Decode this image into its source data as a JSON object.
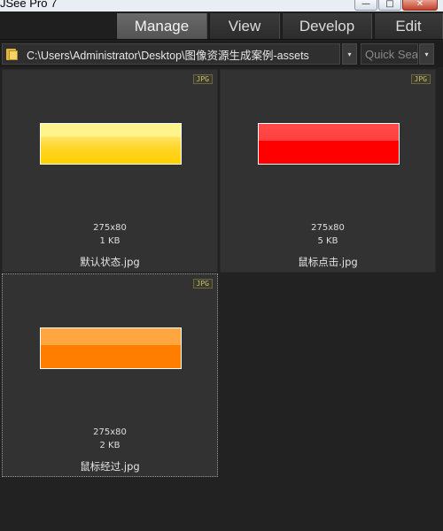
{
  "window": {
    "title": "JSee Pro 7",
    "min_glyph": "—",
    "max_glyph": "□",
    "close_glyph": "✕"
  },
  "mode_tabs": [
    {
      "label": "Manage",
      "active": true
    },
    {
      "label": "View",
      "active": false
    },
    {
      "label": "Develop",
      "active": false
    },
    {
      "label": "Edit",
      "active": false
    }
  ],
  "pathbar": {
    "path": "C:\\Users\\Administrator\\Desktop\\图像资源生成案例-assets",
    "search_placeholder": "Quick Search",
    "dropdown_glyph": "▾"
  },
  "thumbnails": [
    {
      "badge": "JPG",
      "dims": "275x80",
      "size": "1 KB",
      "filename": "默认状态.jpg",
      "color": "#ffd000"
    },
    {
      "badge": "JPG",
      "dims": "275x80",
      "size": "5 KB",
      "filename": "鼠标点击.jpg",
      "color": "#ff0000"
    },
    {
      "badge": "JPG",
      "dims": "275x80",
      "size": "2 KB",
      "filename": "鼠标经过.jpg",
      "color": "#ff7e00",
      "selected": true
    }
  ],
  "colors": {
    "background": "#222222",
    "panel": "#323232",
    "active_tab": "#5e5e5e"
  }
}
